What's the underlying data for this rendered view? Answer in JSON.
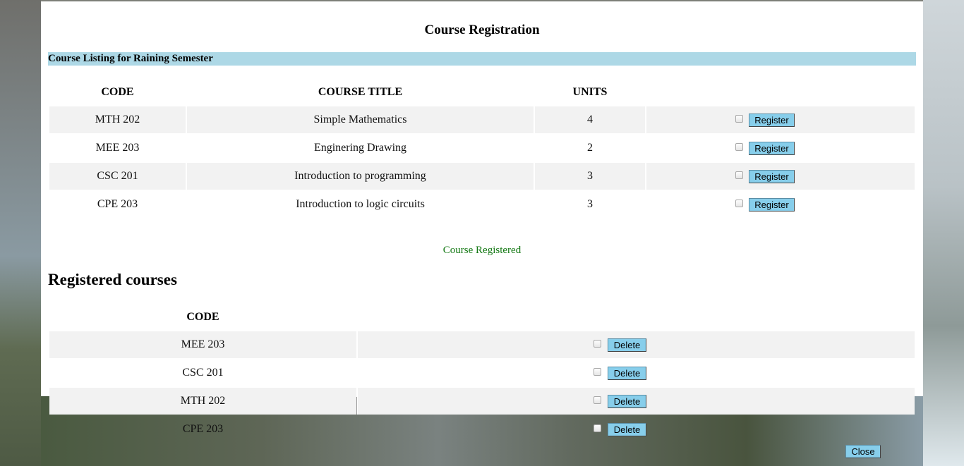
{
  "title": "Course Registration",
  "listing_header": "Course Listing for Raining Semester",
  "columns": {
    "code": "CODE",
    "title": "COURSE TITLE",
    "units": "UNITS"
  },
  "courses": [
    {
      "code": "MTH 202",
      "title": "Simple Mathematics",
      "units": "4",
      "action": "Register"
    },
    {
      "code": "MEE 203",
      "title": "Enginering Drawing",
      "units": "2",
      "action": "Register"
    },
    {
      "code": "CSC 201",
      "title": "Introduction to programming",
      "units": "3",
      "action": "Register"
    },
    {
      "code": "CPE 203",
      "title": "Introduction to logic circuits",
      "units": "3",
      "action": "Register"
    }
  ],
  "status_message": "Course Registered",
  "registered": {
    "heading": "Registered courses",
    "column_code": "CODE",
    "items": [
      {
        "code": "MEE 203",
        "action": "Delete"
      },
      {
        "code": "CSC 201",
        "action": "Delete"
      },
      {
        "code": "MTH 202",
        "action": "Delete"
      },
      {
        "code": "CPE 203",
        "action": "Delete"
      }
    ]
  },
  "close_label": "Close",
  "colors": {
    "header_bar": "#add8e6",
    "button": "#87ceeb",
    "status": "#117711",
    "row_shade": "#f2f2f2"
  }
}
